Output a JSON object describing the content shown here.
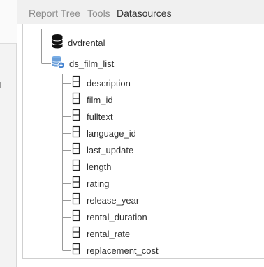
{
  "tabs": [
    {
      "label": "Report Tree",
      "active": false
    },
    {
      "label": "Tools",
      "active": false
    },
    {
      "label": "Datasources",
      "active": true
    }
  ],
  "tree": {
    "database": {
      "label": "dvdrental",
      "icon": "database-icon"
    },
    "datasource": {
      "label": "ds_film_list",
      "icon": "datasource-icon"
    },
    "fields": [
      "description",
      "film_id",
      "fulltext",
      "language_id",
      "last_update",
      "length",
      "rating",
      "release_year",
      "rental_duration",
      "rental_rate",
      "replacement_cost"
    ]
  },
  "colors": {
    "tab_active": "#333333",
    "tab_inactive": "#8c8c8c",
    "datasource_icon": "#6a9ed8"
  }
}
